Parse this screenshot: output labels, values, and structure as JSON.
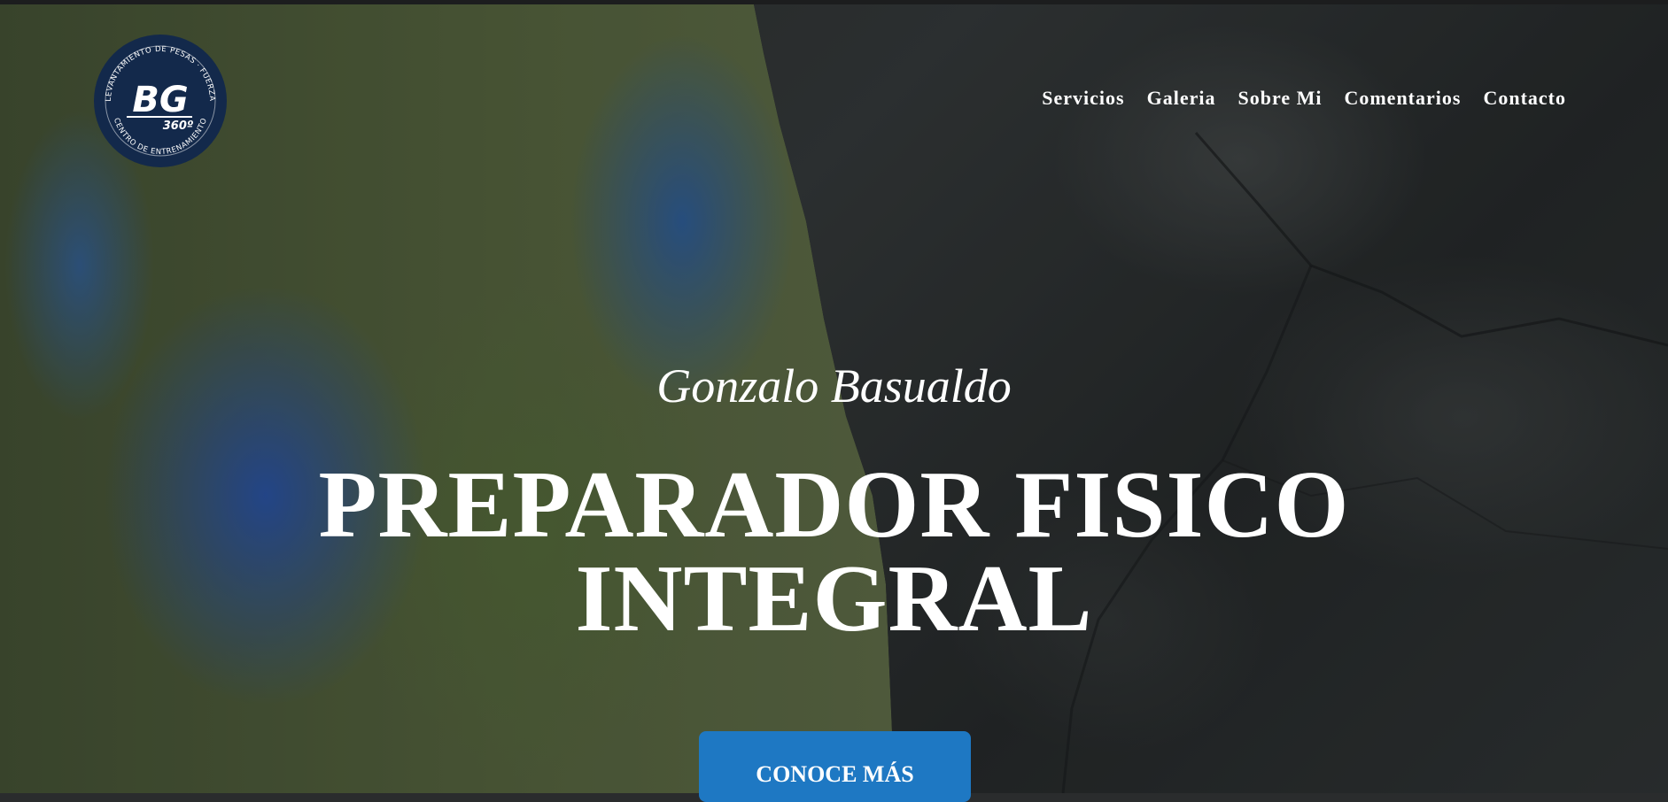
{
  "logo": {
    "ring_top_text": "LEVANTAMIENTO DE PESAS · FUERZA",
    "ring_bottom_text": "CENTRO DE ENTRENAMIENTO",
    "monogram": "BG",
    "degrees": "360º",
    "color": "#13294b"
  },
  "nav": {
    "items": [
      "Servicios",
      "Galeria",
      "Sobre Mi",
      "Comentarios",
      "Contacto"
    ]
  },
  "hero": {
    "subtitle": "Gonzalo Basualdo",
    "headline_line1": "PREPARADOR FISICO",
    "headline_line2": "INTEGRAL",
    "cta_label": "CONOCE MÁS",
    "cta_color": "#1e78c3"
  }
}
